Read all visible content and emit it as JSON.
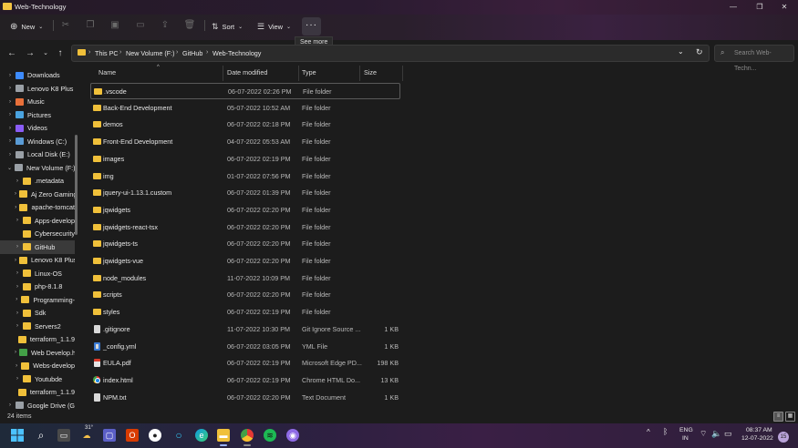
{
  "window": {
    "title": "Web-Technology",
    "controls": {
      "minimize": "—",
      "maximize": "❐",
      "close": "✕"
    }
  },
  "toolbar": {
    "new_label": "New",
    "sort_label": "Sort",
    "view_label": "View",
    "more_label": "···",
    "tooltip": "See more"
  },
  "address": {
    "crumbs": [
      "This PC",
      "New Volume (F:)",
      "GitHub",
      "Web-Technology"
    ],
    "search_placeholder": "Search Web-Techn..."
  },
  "sidebar": {
    "items": [
      {
        "label": "Downloads",
        "icon": "download-icon",
        "color": "#3d8bfd",
        "chev": "›"
      },
      {
        "label": "Lenovo K8 Plus",
        "icon": "phone-icon",
        "color": "#9aa0a6",
        "chev": "›"
      },
      {
        "label": "Music",
        "icon": "music-icon",
        "color": "#e8703a",
        "chev": "›"
      },
      {
        "label": "Pictures",
        "icon": "pictures-icon",
        "color": "#4aa3df",
        "chev": "›"
      },
      {
        "label": "Videos",
        "icon": "videos-icon",
        "color": "#8a5cf5",
        "chev": "›"
      },
      {
        "label": "Windows (C:)",
        "icon": "drive-icon",
        "color": "#5a9bd5",
        "chev": "›"
      },
      {
        "label": "Local Disk (E:)",
        "icon": "drive-icon",
        "color": "#9aa0a6",
        "chev": "›"
      },
      {
        "label": "New Volume (F:)",
        "icon": "drive-icon",
        "color": "#9aa0a6",
        "chev": "⌄"
      },
      {
        "label": ".metadata",
        "icon": "folder-icon",
        "color": "#f0c03a",
        "chev": "›"
      },
      {
        "label": "Aj Zero Gaming",
        "icon": "folder-icon",
        "color": "#f0c03a",
        "chev": "›"
      },
      {
        "label": "apache-tomcat",
        "icon": "folder-icon",
        "color": "#f0c03a",
        "chev": "›"
      },
      {
        "label": "Apps-develop",
        "icon": "folder-icon",
        "color": "#f0c03a",
        "chev": "›"
      },
      {
        "label": "Cybersecurity",
        "icon": "folder-icon",
        "color": "#f0c03a",
        "chev": ""
      },
      {
        "label": "GitHub",
        "icon": "folder-icon",
        "color": "#f0c03a",
        "chev": "›",
        "selected": true
      },
      {
        "label": "Lenovo K8 Plus",
        "icon": "folder-icon",
        "color": "#f0c03a",
        "chev": "›"
      },
      {
        "label": "Linux-OS",
        "icon": "folder-icon",
        "color": "#f0c03a",
        "chev": "›"
      },
      {
        "label": "php-8.1.8",
        "icon": "folder-icon",
        "color": "#f0c03a",
        "chev": "›"
      },
      {
        "label": "Programming-",
        "icon": "folder-icon",
        "color": "#f0c03a",
        "chev": "›"
      },
      {
        "label": "Sdk",
        "icon": "folder-icon",
        "color": "#f0c03a",
        "chev": "›"
      },
      {
        "label": "Servers2",
        "icon": "folder-icon",
        "color": "#f0c03a",
        "chev": "›"
      },
      {
        "label": "terraform_1.1.9",
        "icon": "folder-icon",
        "color": "#f0c03a",
        "chev": ""
      },
      {
        "label": "Web Develop.h",
        "icon": "chrome-icon",
        "color": "#43a047",
        "chev": "›"
      },
      {
        "label": "Webs-develop",
        "icon": "folder-icon",
        "color": "#f0c03a",
        "chev": "›"
      },
      {
        "label": "Youtubde",
        "icon": "folder-icon",
        "color": "#f0c03a",
        "chev": "›"
      },
      {
        "label": "terraform_1.1.9",
        "icon": "folder-icon",
        "color": "#f0c03a",
        "chev": ""
      },
      {
        "label": "Google Drive (G",
        "icon": "drive-icon",
        "color": "#9aa0a6",
        "chev": "›"
      }
    ]
  },
  "columns": {
    "name": "Name",
    "date": "Date modified",
    "type": "Type",
    "size": "Size"
  },
  "files": [
    {
      "name": ".vscode",
      "date": "06-07-2022 02:26 PM",
      "type": "File folder",
      "size": "",
      "kind": "folder",
      "focused": true
    },
    {
      "name": "Back-End Development",
      "date": "05-07-2022 10:52 AM",
      "type": "File folder",
      "size": "",
      "kind": "folder"
    },
    {
      "name": "demos",
      "date": "06-07-2022 02:18 PM",
      "type": "File folder",
      "size": "",
      "kind": "folder"
    },
    {
      "name": "Front-End Development",
      "date": "04-07-2022 05:53 AM",
      "type": "File folder",
      "size": "",
      "kind": "folder"
    },
    {
      "name": "images",
      "date": "06-07-2022 02:19 PM",
      "type": "File folder",
      "size": "",
      "kind": "folder"
    },
    {
      "name": "img",
      "date": "01-07-2022 07:56 PM",
      "type": "File folder",
      "size": "",
      "kind": "folder"
    },
    {
      "name": "jquery-ui-1.13.1.custom",
      "date": "06-07-2022 01:39 PM",
      "type": "File folder",
      "size": "",
      "kind": "folder"
    },
    {
      "name": "jqwidgets",
      "date": "06-07-2022 02:20 PM",
      "type": "File folder",
      "size": "",
      "kind": "folder"
    },
    {
      "name": "jqwidgets-react-tsx",
      "date": "06-07-2022 02:20 PM",
      "type": "File folder",
      "size": "",
      "kind": "folder"
    },
    {
      "name": "jqwidgets-ts",
      "date": "06-07-2022 02:20 PM",
      "type": "File folder",
      "size": "",
      "kind": "folder"
    },
    {
      "name": "jqwidgets-vue",
      "date": "06-07-2022 02:20 PM",
      "type": "File folder",
      "size": "",
      "kind": "folder"
    },
    {
      "name": "node_modules",
      "date": "11-07-2022 10:09 PM",
      "type": "File folder",
      "size": "",
      "kind": "folder"
    },
    {
      "name": "scripts",
      "date": "06-07-2022 02:20 PM",
      "type": "File folder",
      "size": "",
      "kind": "folder"
    },
    {
      "name": "styles",
      "date": "06-07-2022 02:19 PM",
      "type": "File folder",
      "size": "",
      "kind": "folder"
    },
    {
      "name": ".gitignore",
      "date": "11-07-2022 10:30 PM",
      "type": "Git Ignore Source ...",
      "size": "1 KB",
      "kind": "file-generic"
    },
    {
      "name": "_config.yml",
      "date": "06-07-2022 03:05 PM",
      "type": "YML File",
      "size": "1 KB",
      "kind": "yml"
    },
    {
      "name": "EULA.pdf",
      "date": "06-07-2022 02:19 PM",
      "type": "Microsoft Edge PD...",
      "size": "198 KB",
      "kind": "pdf"
    },
    {
      "name": "index.html",
      "date": "06-07-2022 02:19 PM",
      "type": "Chrome HTML Do...",
      "size": "13 KB",
      "kind": "chrome"
    },
    {
      "name": "NPM.txt",
      "date": "06-07-2022 02:20 PM",
      "type": "Text Document",
      "size": "1 KB",
      "kind": "file-generic"
    }
  ],
  "status": {
    "items_count": "24 items"
  },
  "taskbar": {
    "weather": "31°",
    "language": "ENG",
    "region": "IN",
    "time": "08:37 AM",
    "date": "12-07-2022",
    "notifications": "15"
  }
}
